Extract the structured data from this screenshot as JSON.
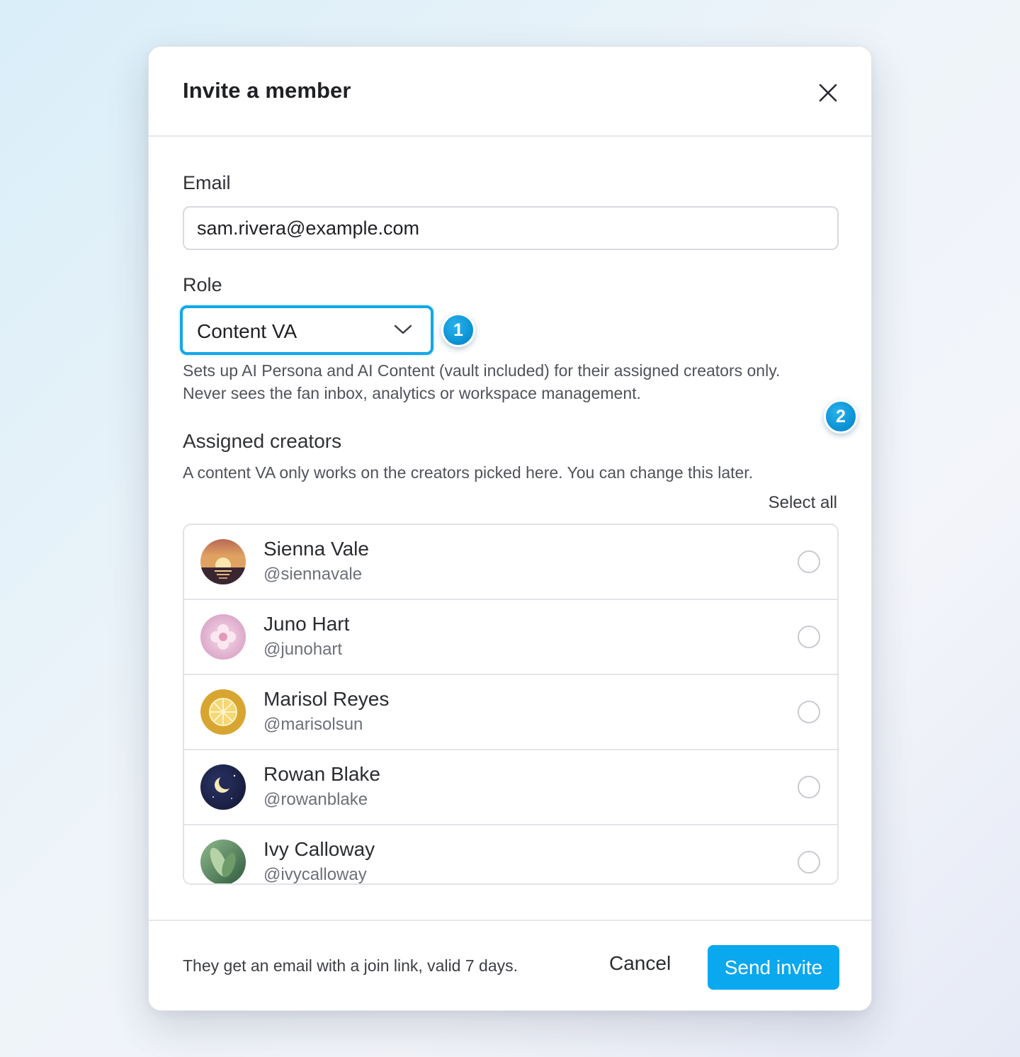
{
  "dialog": {
    "title": "Invite a member"
  },
  "email": {
    "label": "Email",
    "value": "sam.rivera@example.com"
  },
  "role": {
    "label": "Role",
    "selected": "Content VA",
    "description_line1": "Sets up AI Persona and AI Content (vault included) for their assigned creators only.",
    "description_line2": "Never sees the fan inbox, analytics or workspace management."
  },
  "badges": [
    "1",
    "2"
  ],
  "assigned": {
    "title": "Assigned creators",
    "description": "A content VA only works on the creators picked here. You can change this later.",
    "select_all": "Select all",
    "creators": [
      {
        "name": "Sienna Vale",
        "handle": "@siennavale",
        "avatar": "sunset-avatar-icon",
        "selected": false
      },
      {
        "name": "Juno Hart",
        "handle": "@junohart",
        "avatar": "flower-avatar-icon",
        "selected": false
      },
      {
        "name": "Marisol Reyes",
        "handle": "@marisolsun",
        "avatar": "citrus-avatar-icon",
        "selected": false
      },
      {
        "name": "Rowan Blake",
        "handle": "@rowanblake",
        "avatar": "moon-avatar-icon",
        "selected": false
      },
      {
        "name": "Ivy Calloway",
        "handle": "@ivycalloway",
        "avatar": "leaf-avatar-icon",
        "selected": false
      }
    ]
  },
  "footer": {
    "note": "They get an email with a join link, valid 7 days.",
    "cancel": "Cancel",
    "send": "Send invite"
  },
  "colors": {
    "accent": "#0aa8ee",
    "focus_ring": "#13a7e8",
    "badge": "#0a8fd2"
  }
}
